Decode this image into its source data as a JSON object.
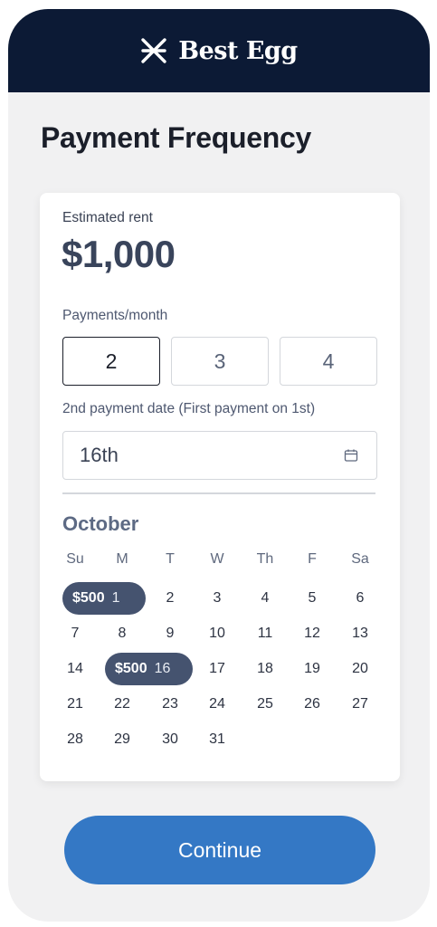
{
  "header": {
    "logo_text": "Best Egg",
    "logo_icon": "best-egg-logo-icon",
    "background": "#0c1a35"
  },
  "page": {
    "title": "Payment Frequency"
  },
  "card": {
    "estimated_rent_label": "Estimated rent",
    "estimated_rent_value": "$1,000",
    "payments_per_month_label": "Payments/month",
    "payment_options": [
      "2",
      "3",
      "4"
    ],
    "selected_option": "2",
    "second_payment_label": "2nd payment date (First payment on 1st)",
    "second_payment_value": "16th",
    "second_payment_icon": "calendar-icon"
  },
  "calendar": {
    "month": "October",
    "weekdays": [
      "Su",
      "M",
      "T",
      "W",
      "Th",
      "F",
      "Sa"
    ],
    "payment_amount": "$500",
    "payment_days": [
      "1",
      "16"
    ],
    "weeks": [
      [
        "",
        "1",
        "2",
        "3",
        "4",
        "5",
        "6"
      ],
      [
        "7",
        "8",
        "9",
        "10",
        "11",
        "12",
        "13"
      ],
      [
        "14",
        "",
        "16",
        "17",
        "18",
        "19",
        "20"
      ],
      [
        "21",
        "22",
        "23",
        "24",
        "25",
        "26",
        "27"
      ],
      [
        "28",
        "29",
        "30",
        "31",
        "",
        "",
        ""
      ]
    ]
  },
  "actions": {
    "continue_label": "Continue",
    "accent": "#3478c5"
  }
}
